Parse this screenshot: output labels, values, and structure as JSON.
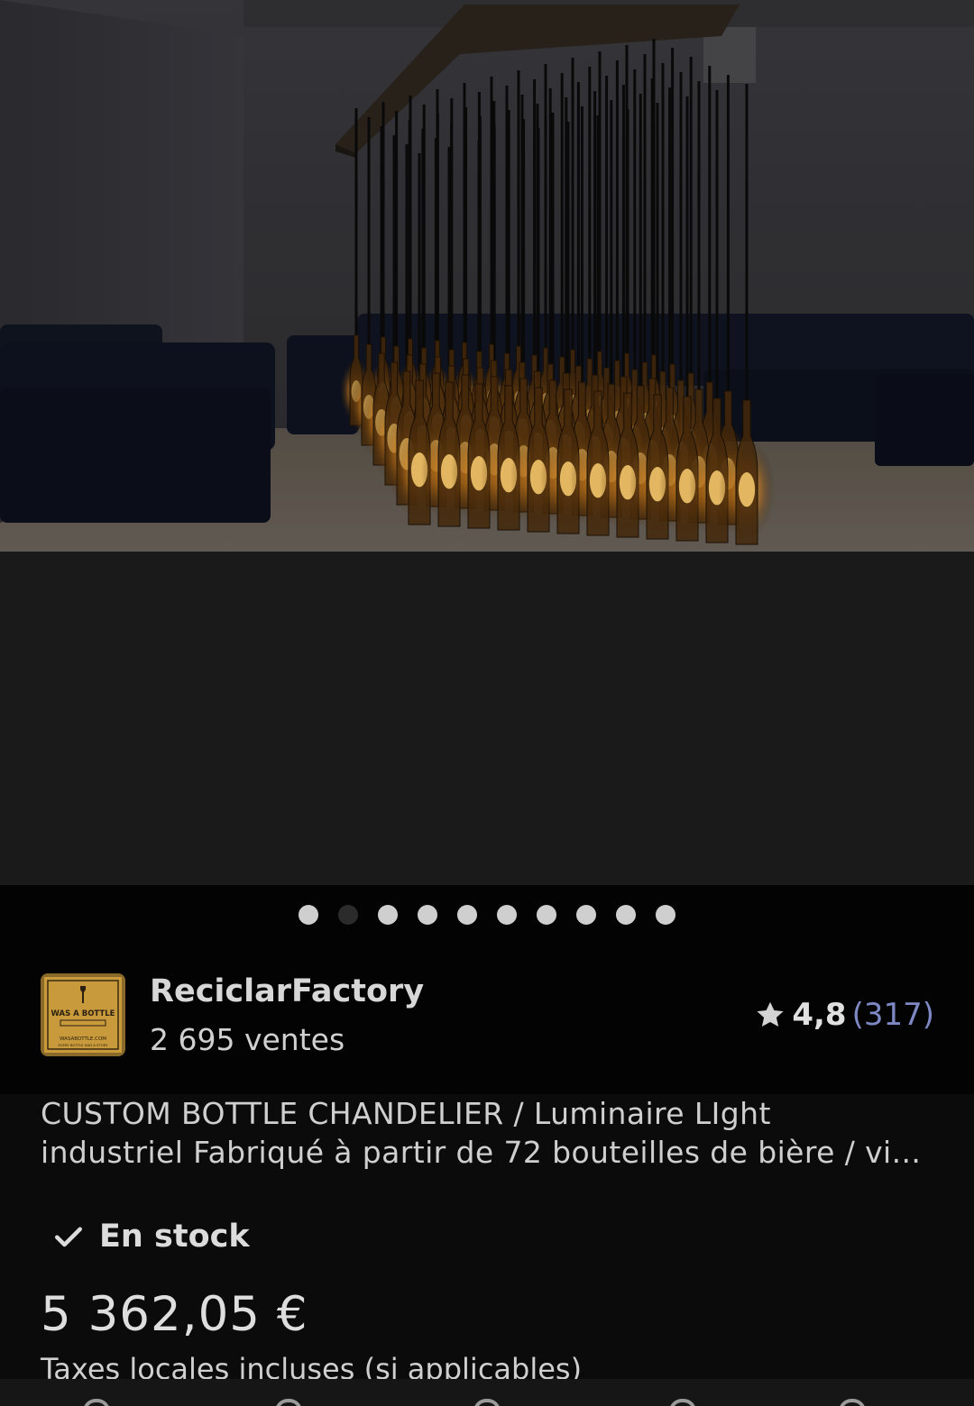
{
  "gallery": {
    "image_alt": "bottle-chandelier-photo",
    "dot_count": 10,
    "active_dot_index": 1
  },
  "shop": {
    "name": "ReciclarFactory",
    "sales": "2 695 ventes",
    "logo_text": [
      "WAS A BOTTLE",
      "WASABOTTLE.COM",
      "EVERY BOTTLE HAD A STORY"
    ],
    "rating": "4,8",
    "rating_count": "(317)"
  },
  "listing": {
    "title_line1": "CUSTOM BOTTLE CHANDELIER / Luminaire LIght",
    "title_line2": "industriel Fabriqué à partir de 72 bouteilles de bière / vi...",
    "stock": "En stock",
    "price": "5 362,05 €",
    "taxes": "Taxes locales incluses (si applicables)"
  },
  "colors": {
    "accent_rating_count": "#7d88c4",
    "background": "#0b0b0b"
  },
  "icons": {
    "rating": "star-icon",
    "stock": "check-icon"
  }
}
